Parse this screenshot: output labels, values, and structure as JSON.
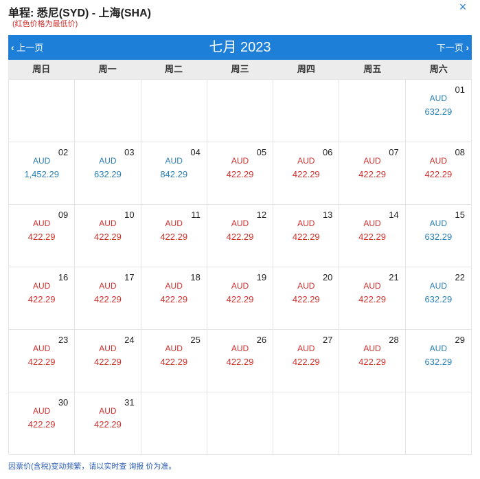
{
  "header": {
    "title": "单程: 悉尼(SYD) - 上海(SHA)",
    "subtitle": "(红色价格为最低价)",
    "close_symbol": "×"
  },
  "nav": {
    "prev_label": "上一页",
    "next_label": "下一页",
    "month_label": "七月 2023",
    "prev_icon": "‹",
    "next_icon": "›"
  },
  "colors": {
    "accent": "#1e7fd8",
    "lowest_price": "#d0312d",
    "normal_price": "#2a7fb4"
  },
  "weekdays": [
    "周日",
    "周一",
    "周二",
    "周三",
    "周四",
    "周五",
    "周六"
  ],
  "calendar": {
    "currency": "AUD",
    "days": [
      {
        "day": "",
        "price": "",
        "low": false
      },
      {
        "day": "",
        "price": "",
        "low": false
      },
      {
        "day": "",
        "price": "",
        "low": false
      },
      {
        "day": "",
        "price": "",
        "low": false
      },
      {
        "day": "",
        "price": "",
        "low": false
      },
      {
        "day": "",
        "price": "",
        "low": false
      },
      {
        "day": "01",
        "price": "632.29",
        "low": false
      },
      {
        "day": "02",
        "price": "1,452.29",
        "low": false
      },
      {
        "day": "03",
        "price": "632.29",
        "low": false
      },
      {
        "day": "04",
        "price": "842.29",
        "low": false
      },
      {
        "day": "05",
        "price": "422.29",
        "low": true
      },
      {
        "day": "06",
        "price": "422.29",
        "low": true
      },
      {
        "day": "07",
        "price": "422.29",
        "low": true
      },
      {
        "day": "08",
        "price": "422.29",
        "low": true
      },
      {
        "day": "09",
        "price": "422.29",
        "low": true
      },
      {
        "day": "10",
        "price": "422.29",
        "low": true
      },
      {
        "day": "11",
        "price": "422.29",
        "low": true
      },
      {
        "day": "12",
        "price": "422.29",
        "low": true
      },
      {
        "day": "13",
        "price": "422.29",
        "low": true
      },
      {
        "day": "14",
        "price": "422.29",
        "low": true
      },
      {
        "day": "15",
        "price": "632.29",
        "low": false
      },
      {
        "day": "16",
        "price": "422.29",
        "low": true
      },
      {
        "day": "17",
        "price": "422.29",
        "low": true
      },
      {
        "day": "18",
        "price": "422.29",
        "low": true
      },
      {
        "day": "19",
        "price": "422.29",
        "low": true
      },
      {
        "day": "20",
        "price": "422.29",
        "low": true
      },
      {
        "day": "21",
        "price": "422.29",
        "low": true
      },
      {
        "day": "22",
        "price": "632.29",
        "low": false
      },
      {
        "day": "23",
        "price": "422.29",
        "low": true
      },
      {
        "day": "24",
        "price": "422.29",
        "low": true
      },
      {
        "day": "25",
        "price": "422.29",
        "low": true
      },
      {
        "day": "26",
        "price": "422.29",
        "low": true
      },
      {
        "day": "27",
        "price": "422.29",
        "low": true
      },
      {
        "day": "28",
        "price": "422.29",
        "low": true
      },
      {
        "day": "29",
        "price": "632.29",
        "low": false
      },
      {
        "day": "30",
        "price": "422.29",
        "low": true
      },
      {
        "day": "31",
        "price": "422.29",
        "low": true
      },
      {
        "day": "",
        "price": "",
        "low": false
      },
      {
        "day": "",
        "price": "",
        "low": false
      },
      {
        "day": "",
        "price": "",
        "low": false
      },
      {
        "day": "",
        "price": "",
        "low": false
      },
      {
        "day": "",
        "price": "",
        "low": false
      }
    ]
  },
  "footer": {
    "note": "因票价(含税)变动频繁，请以实时查 询报 价为准。"
  }
}
